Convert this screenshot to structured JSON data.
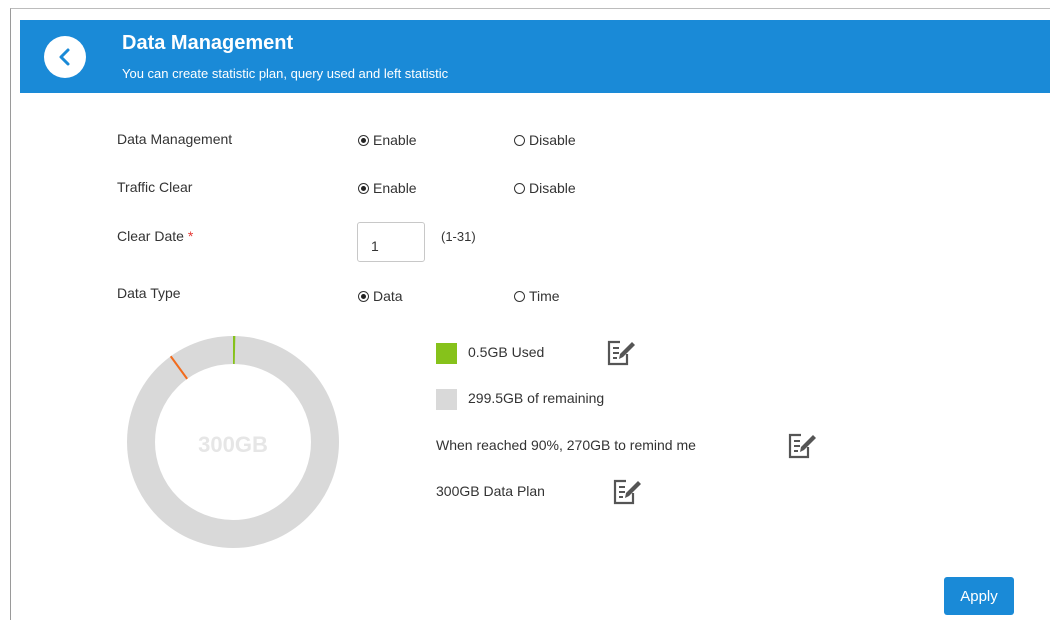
{
  "header": {
    "title": "Data Management",
    "subtitle": "You can create statistic plan, query used and left statistic",
    "back_icon": "chevron-left-icon"
  },
  "form": {
    "data_management": {
      "label": "Data Management",
      "options": [
        "Enable",
        "Disable"
      ],
      "selected": "Enable"
    },
    "traffic_clear": {
      "label": "Traffic Clear",
      "options": [
        "Enable",
        "Disable"
      ],
      "selected": "Enable"
    },
    "clear_date": {
      "label": "Clear Date",
      "required_mark": "*",
      "value": "1",
      "range_hint": "(1-31)"
    },
    "data_type": {
      "label": "Data Type",
      "options": [
        "Data",
        "Time"
      ],
      "selected": "Data"
    }
  },
  "usage": {
    "total_label": "300GB",
    "used_fraction": 0.0017,
    "reminder_fraction": 0.9,
    "used_text": "0.5GB Used",
    "remaining_text": "299.5GB of remaining",
    "reminder_text": "When reached 90%, 270GB to remind me",
    "plan_text": "300GB Data Plan",
    "colors": {
      "used": "#86c21b",
      "remaining": "#d9d9d9",
      "reminder_marker": "#f26b1d",
      "center_text": "#e6e6e6"
    }
  },
  "actions": {
    "apply_label": "Apply"
  },
  "theme": {
    "accent": "#1a8ad7"
  }
}
